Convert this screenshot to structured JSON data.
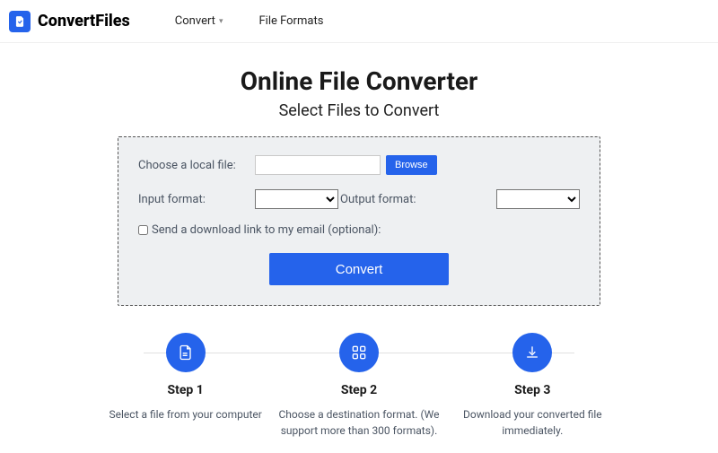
{
  "brand": "ConvertFiles",
  "nav": {
    "convert": "Convert",
    "fileformats": "File Formats"
  },
  "hero": {
    "title": "Online File Converter",
    "subtitle": "Select Files to Convert"
  },
  "panel": {
    "choose_label": "Choose a local file:",
    "browse": "Browse",
    "input_format_label": "Input format:",
    "output_format_label": "Output format:",
    "email_label": "Send a download link to my email (optional):",
    "convert": "Convert"
  },
  "steps": [
    {
      "title": "Step 1",
      "desc": "Select a file from your computer"
    },
    {
      "title": "Step 2",
      "desc": "Choose a destination format. (We support more than 300 formats)."
    },
    {
      "title": "Step 3",
      "desc": "Download your converted file immediately."
    }
  ]
}
